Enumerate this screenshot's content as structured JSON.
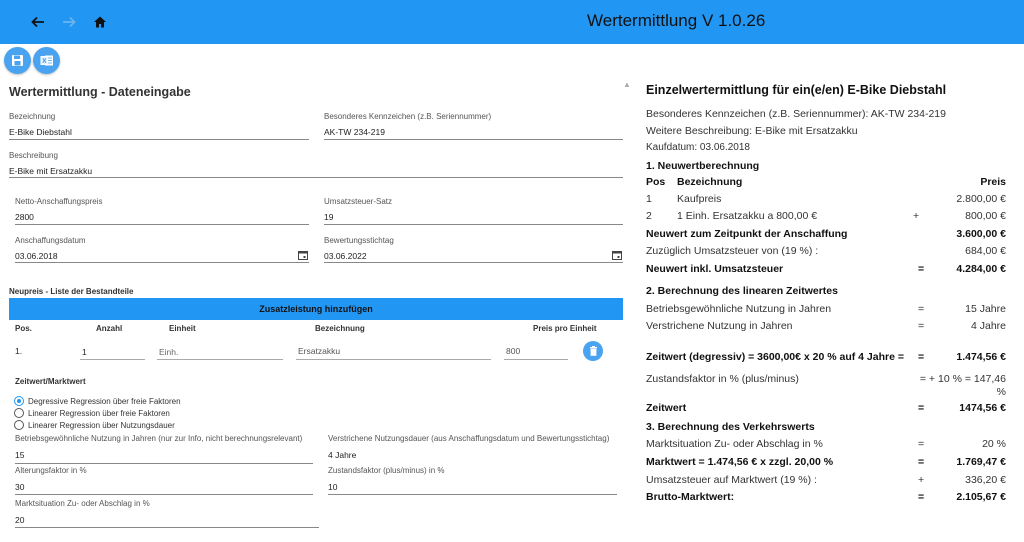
{
  "app": {
    "title": "Wertermittlung V 1.0.26"
  },
  "colors": {
    "accent": "#2196f3",
    "fab": "#4aa3f0"
  },
  "icons": {
    "back": "arrow-left",
    "forward": "arrow-right",
    "home": "home",
    "save": "floppy-disk",
    "export": "excel-export",
    "delete": "trash",
    "calendar": "calendar",
    "collapse": "chevron-up"
  },
  "form": {
    "heading": "Wertermittlung - Dateneingabe",
    "bezeichnung": {
      "label": "Bezeichnung",
      "value": "E-Bike Diebstahl"
    },
    "kennzeichen": {
      "label": "Besonderes Kennzeichen (z.B. Seriennummer)",
      "value": "AK-TW 234-219"
    },
    "beschreibung": {
      "label": "Beschreibung",
      "value": "E-Bike mit Ersatzakku"
    },
    "netto": {
      "label": "Netto-Anschaffungspreis",
      "value": "2800"
    },
    "ust": {
      "label": "Umsatzsteuer-Satz",
      "value": "19"
    },
    "anschaffungsdatum": {
      "label": "Anschaffungsdatum",
      "value": "03.06.2018"
    },
    "stichtag": {
      "label": "Bewertungsstichtag",
      "value": "03.06.2022"
    },
    "neupreis_heading": "Neupreis - Liste der Bestandteile",
    "add_button": "Zusatzleistung hinzufügen",
    "table": {
      "headers": {
        "pos": "Pos.",
        "anzahl": "Anzahl",
        "einheit": "Einheit",
        "bezeichnung": "Bezeichnung",
        "preis": "Preis pro Einheit"
      },
      "row": {
        "pos": "1.",
        "anzahl": "1",
        "einheit": "Einh.",
        "bezeichnung": "Ersatzakku",
        "preis": "800"
      }
    },
    "zeitwert_heading": "Zeitwert/Marktwert",
    "radios": [
      {
        "label": "Degressive Regression über freie Faktoren",
        "checked": true
      },
      {
        "label": "Linearer Regression über freie Faktoren",
        "checked": false
      },
      {
        "label": "Linearer Regression über Nutzungsdauer",
        "checked": false
      }
    ],
    "nutzung": {
      "label": "Betriebsgewöhnliche Nutzung in Jahren (nur zur Info, nicht berechnungsrelevant)",
      "value": "15"
    },
    "verstrichen": {
      "label": "Verstrichene Nutzungsdauer (aus Anschaffungsdatum und Bewertungsstichtag)",
      "value": "4 Jahre"
    },
    "alterung": {
      "label": "Alterungsfaktor in %",
      "value": "30"
    },
    "zustand": {
      "label": "Zustandsfaktor (plus/minus) in %",
      "value": "10"
    },
    "markt": {
      "label": "Marktsituation Zu- oder Abschlag in %",
      "value": "20"
    }
  },
  "report": {
    "title": "Einzelwertermittlung für ein(e/en) E-Bike Diebstahl",
    "kennzeichen": "Besonderes Kennzeichen (z.B. Seriennummer): AK-TW 234-219",
    "beschreibung": "Weitere Beschreibung: E-Bike mit Ersatzakku",
    "kaufdatum": "Kaufdatum: 03.06.2018",
    "s1": "1. Neuwertberechnung",
    "cols": {
      "pos": "Pos",
      "bez": "Bezeichnung",
      "preis": "Preis"
    },
    "items": [
      {
        "pos": "1",
        "bez": "Kaufpreis",
        "op": "",
        "val": "2.800,00 €"
      },
      {
        "pos": "2",
        "bez": "1 Einh. Ersatzakku a 800,00 €",
        "op": "+",
        "val": "800,00 €"
      }
    ],
    "neuwert": {
      "label": "Neuwert zum Zeitpunkt der Anschaffung",
      "val": "3.600,00 €"
    },
    "ust": {
      "label": "Zuzüglich Umsatzsteuer von  (19 %) :",
      "val": "684,00 €"
    },
    "neuwert_inkl": {
      "label": "Neuwert inkl. Umsatzsteuer",
      "op": "=",
      "val": "4.284,00 €"
    },
    "s2": "2. Berechnung des linearen Zeitwertes",
    "nutzung": {
      "label": "Betriebsgewöhnliche Nutzung in Jahren",
      "op": "=",
      "val": "15 Jahre"
    },
    "verstrichen": {
      "label": "Verstrichene Nutzung in Jahren",
      "op": "=",
      "val": "4 Jahre"
    },
    "zeitwert_deg": {
      "label": "Zeitwert (degressiv) = 3600,00€ x 20 % auf 4 Jahre =",
      "op": "=",
      "val": "1.474,56 €"
    },
    "zustand": {
      "label": "Zustandsfaktor in % (plus/minus)",
      "val1": "= + 10 % = 147,46",
      "val2": "%"
    },
    "zeitwert": {
      "label": "Zeitwert",
      "op": "=",
      "val": "1474,56 €"
    },
    "s3": "3. Berechnung des Verkehrswerts",
    "marktsituation": {
      "label": "Marktsituation Zu- oder Abschlag in %",
      "op": "=",
      "val": "20 %"
    },
    "marktwert": {
      "label": "Marktwert = 1.474,56 € x zzgl. 20,00 %",
      "op": "=",
      "val": "1.769,47 €"
    },
    "ust_markt": {
      "label": "Umsatzsteuer auf Marktwert  (19 %) :",
      "op": "+",
      "val": "336,20 €"
    },
    "brutto": {
      "label": "Brutto-Marktwert:",
      "op": "=",
      "val": "2.105,67 €"
    }
  }
}
